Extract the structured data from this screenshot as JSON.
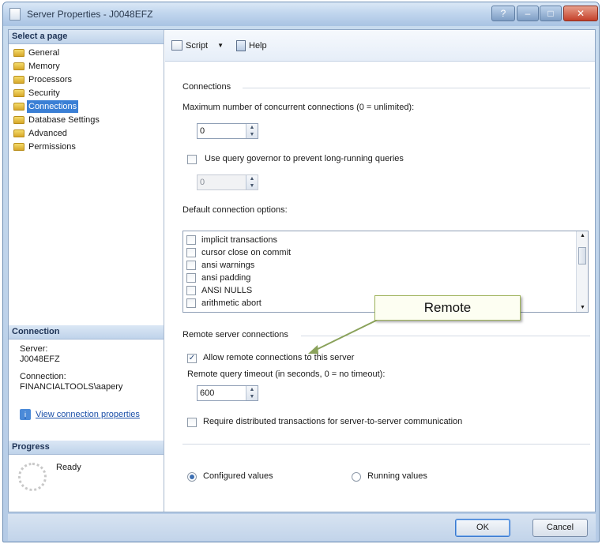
{
  "window": {
    "title": "Server Properties - J0048EFZ"
  },
  "sidebar": {
    "select_page_header": "Select a page",
    "items": [
      {
        "label": "General",
        "selected": false
      },
      {
        "label": "Memory",
        "selected": false
      },
      {
        "label": "Processors",
        "selected": false
      },
      {
        "label": "Security",
        "selected": false
      },
      {
        "label": "Connections",
        "selected": true
      },
      {
        "label": "Database Settings",
        "selected": false
      },
      {
        "label": "Advanced",
        "selected": false
      },
      {
        "label": "Permissions",
        "selected": false
      }
    ],
    "connection_header": "Connection",
    "server_label": "Server:",
    "server_value": "J0048EFZ",
    "connection_label": "Connection:",
    "connection_value": "FINANCIALTOOLS\\aapery",
    "view_link": "View connection properties",
    "progress_header": "Progress",
    "progress_status": "Ready"
  },
  "toolbar": {
    "script_label": "Script",
    "help_label": "Help"
  },
  "connections": {
    "section_title": "Connections",
    "max_connections_label": "Maximum number of concurrent connections (0 = unlimited):",
    "max_connections_value": "0",
    "query_governor_label": "Use query governor to prevent long-running queries",
    "query_governor_checked": false,
    "query_governor_value": "0",
    "default_options_label": "Default connection options:",
    "default_options": [
      {
        "label": "implicit transactions",
        "checked": false
      },
      {
        "label": "cursor close on commit",
        "checked": false
      },
      {
        "label": "ansi warnings",
        "checked": false
      },
      {
        "label": "ansi padding",
        "checked": false
      },
      {
        "label": "ANSI NULLS",
        "checked": false
      },
      {
        "label": "arithmetic abort",
        "checked": false
      }
    ]
  },
  "remote": {
    "section_title": "Remote server connections",
    "allow_remote_label": "Allow remote connections to this server",
    "allow_remote_checked": true,
    "timeout_label": "Remote query timeout (in seconds, 0 = no timeout):",
    "timeout_value": "600",
    "distributed_label": "Require distributed transactions for server-to-server communication",
    "distributed_checked": false
  },
  "values_mode": {
    "configured_label": "Configured values",
    "running_label": "Running values",
    "selected": "configured"
  },
  "callout": {
    "text": "Remote"
  },
  "footer": {
    "ok_label": "OK",
    "cancel_label": "Cancel"
  }
}
